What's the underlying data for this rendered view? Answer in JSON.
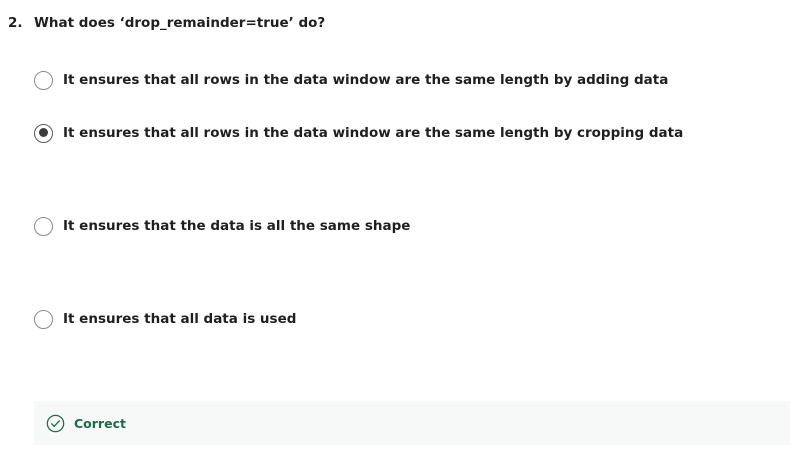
{
  "question": {
    "number": "2.",
    "text": "What does ‘drop_remainder=true’ do?"
  },
  "options": [
    {
      "label": "It ensures that all rows in the data window are the same length by adding data",
      "selected": false
    },
    {
      "label": "It ensures that all rows in the data window are the same length by cropping data",
      "selected": true
    },
    {
      "label": "It ensures that the data is all the same shape",
      "selected": false
    },
    {
      "label": "It ensures that all data is used",
      "selected": false
    }
  ],
  "feedback": {
    "label": "Correct",
    "icon": "check-circle-icon",
    "color": "#1b6b4a",
    "background": "#f6f9f8"
  }
}
